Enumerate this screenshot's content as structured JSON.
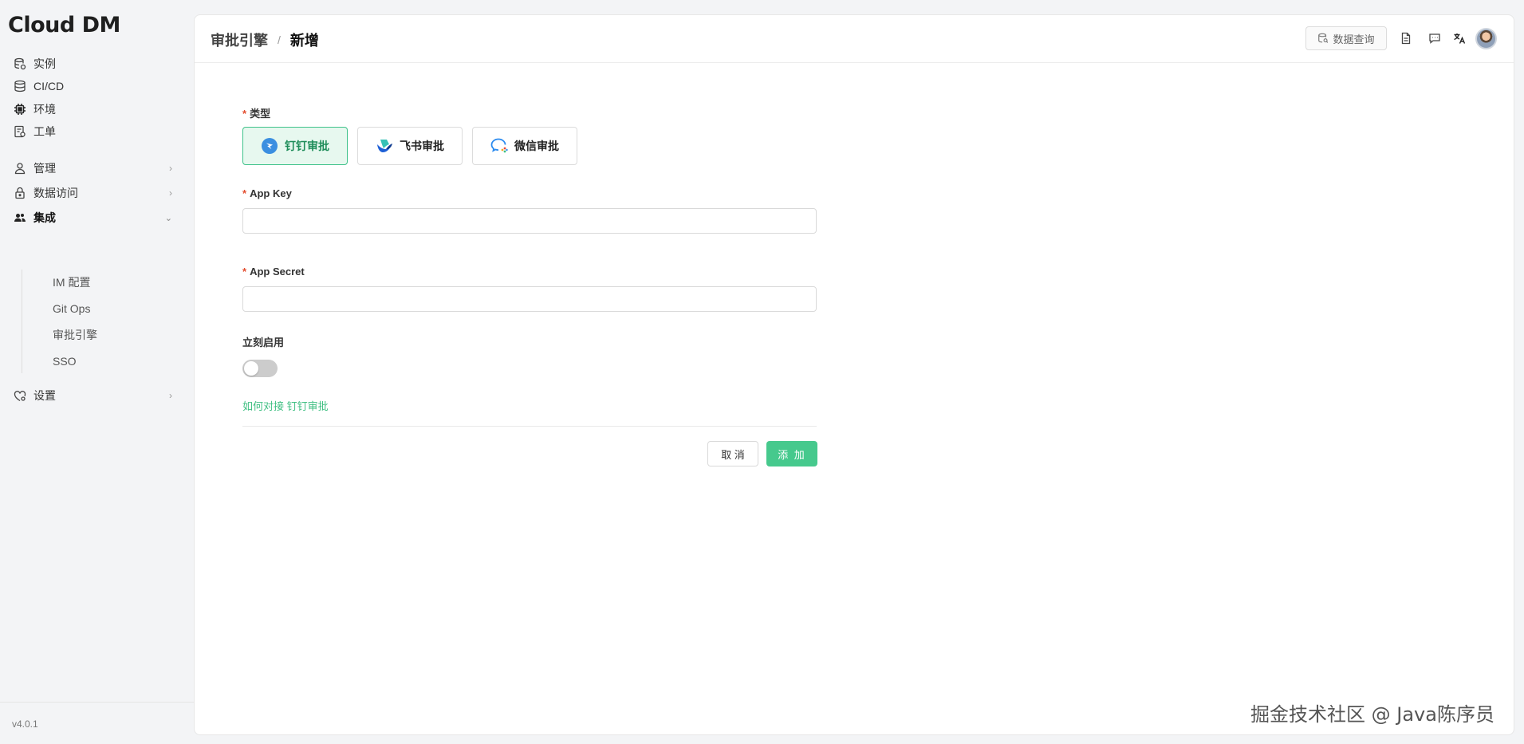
{
  "app": {
    "logo": "Cloud DM",
    "version": "v4.0.1"
  },
  "sidebar": {
    "items": [
      {
        "label": "实例",
        "icon": "database-stack-icon"
      },
      {
        "label": "CI/CD",
        "icon": "database-icon"
      },
      {
        "label": "环境",
        "icon": "chip-icon"
      },
      {
        "label": "工单",
        "icon": "ticket-icon"
      },
      {
        "label": "管理",
        "icon": "user-icon"
      },
      {
        "label": "数据访问",
        "icon": "lock-icon"
      },
      {
        "label": "集成",
        "icon": "users-icon"
      },
      {
        "label": "设置",
        "icon": "settings-icon"
      }
    ],
    "sub_items": [
      "IM 配置",
      "Git Ops",
      "审批引擎",
      "SSO"
    ]
  },
  "header": {
    "breadcrumb_parent": "审批引擎",
    "breadcrumb_sep": "/",
    "breadcrumb_current": "新增",
    "query_button": "数据查询"
  },
  "form": {
    "type_label": "类型",
    "types": [
      "钉钉审批",
      "飞书审批",
      "微信审批"
    ],
    "selected_type": "钉钉审批",
    "app_key_label": "App Key",
    "app_key_value": "",
    "app_secret_label": "App Secret",
    "app_secret_value": "",
    "enable_label": "立刻启用",
    "enabled": false,
    "help_link": "如何对接 钉钉审批",
    "cancel": "取 消",
    "submit": "添 加"
  },
  "watermark": "掘金技术社区 @ Java陈序员",
  "colors": {
    "accent": "#46c98d",
    "required": "#e34d2f"
  }
}
